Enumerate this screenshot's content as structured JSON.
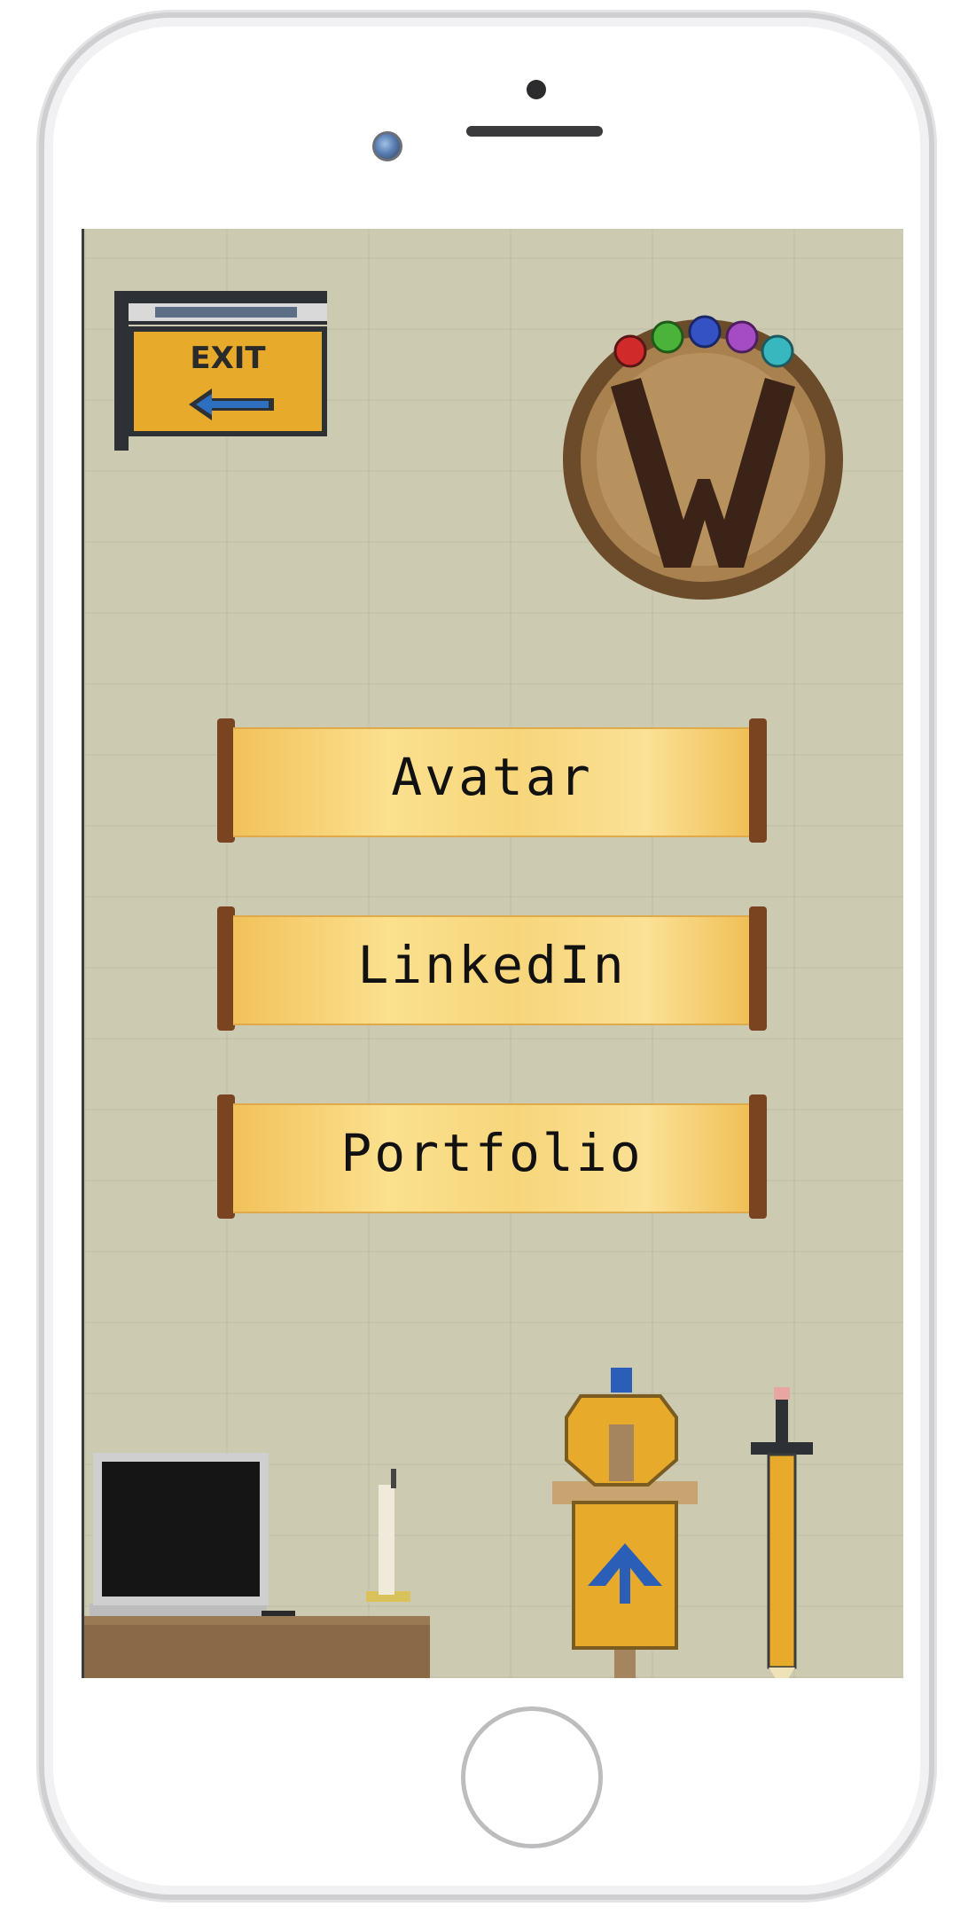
{
  "exit_sign": {
    "label": "EXIT"
  },
  "menu": {
    "items": [
      {
        "label": "Avatar"
      },
      {
        "label": "LinkedIn"
      },
      {
        "label": "Portfolio"
      }
    ]
  },
  "colors": {
    "background": "#cdcab2",
    "scroll_paper": "#f7d67b",
    "scroll_rod": "#7a4420",
    "sign_board": "#e8aa2b",
    "logo_ring": "#6b4b2a",
    "logo_letter": "#3b2417"
  },
  "icons": [
    "exit-sign-icon",
    "w-logo-icon",
    "laptop-icon",
    "candle-icon",
    "armor-stand-icon",
    "sword-pencil-icon"
  ]
}
